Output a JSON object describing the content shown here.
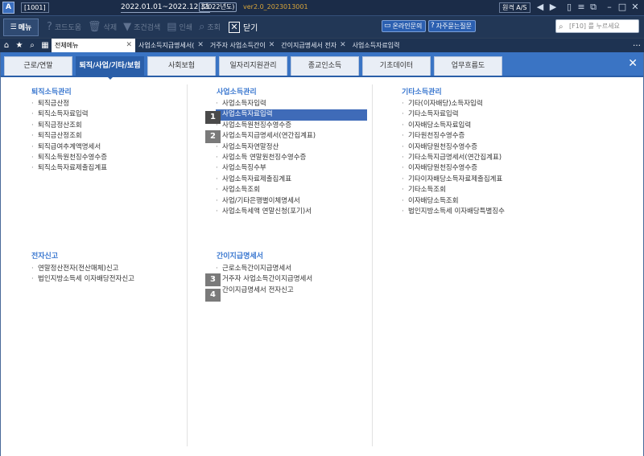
{
  "titlebar": {
    "company_code": "[1001]",
    "period": "2022.01.01~2022.12.31",
    "period_year": "(2022년도)",
    "version": "ver2.0_2023013001",
    "remote_label": "원격 A/S"
  },
  "toolbar": {
    "menu_label": "메뉴",
    "code_help": "코드도움",
    "delete": "삭제",
    "condition_search": "조건검색",
    "print": "인쇄",
    "inquiry": "조회",
    "close": "닫기",
    "online_inquiry": "온라인문의",
    "faq": "자주묻는질문",
    "search_placeholder": "[F10] 를 누르세요"
  },
  "doc_tabs": [
    {
      "label": "전체메뉴"
    },
    {
      "label": "사업소득지급명세서("
    },
    {
      "label": "거주자 사업소득간이"
    },
    {
      "label": "간이지급명세서 전자"
    },
    {
      "label": "사업소득자료입력"
    }
  ],
  "tab_overflow": "…",
  "category_tabs": [
    "근로/연말",
    "퇴직/사업/기타/보험",
    "사회보험",
    "일자리지원관리",
    "종교인소득",
    "기초데이터",
    "업무흐름도"
  ],
  "active_category_index": 1,
  "sections": {
    "retirement": {
      "title": "퇴직소득관리",
      "items": [
        "퇴직금산정",
        "퇴직소득자료입력",
        "퇴직금정산조회",
        "퇴직금산정조회",
        "퇴직급여추계액명세서",
        "퇴직소득원천징수영수증",
        "퇴직소득자료제출집계표"
      ]
    },
    "business": {
      "title": "사업소득관리",
      "items": [
        "사업소득자입력",
        "사업소득자료입력",
        "사업소득원천징수영수증",
        "사업소득지급명세서(연간집계표)",
        "사업소득자연말정산",
        "사업소득 연말원천징수영수증",
        "사업소득징수부",
        "사업소득자료제출집계표",
        "사업소득조회",
        "사업/기타은행별이체명세서",
        "사업소득세액 연말신청(포기)서"
      ],
      "highlight_index": 1
    },
    "other": {
      "title": "기타소득관리",
      "items": [
        "기타(이자배당)소득자입력",
        "기타소득자료입력",
        "이자배당소득자료입력",
        "기타원천징수영수증",
        "이자배당원천징수영수증",
        "기타소득지급명세서(연간집계표)",
        "이자배당원천징수영수증",
        "기타이자배당소득자료제출집계표",
        "기타소득조회",
        "이자배당소득조회",
        "법인지방소득세 이자배당특별징수"
      ]
    },
    "e_filing": {
      "title": "전자신고",
      "items": [
        "연말정산전자(전산매체)신고",
        "법인지방소득세 이자배당전자신고"
      ]
    },
    "simple_statement": {
      "title": "간이지급명세서",
      "items": [
        "근로소득간이지급명세서",
        "거주자 사업소득간이지급명세서",
        "간이지급명세서 전자신고"
      ]
    }
  },
  "badges": [
    "1",
    "2",
    "3",
    "4"
  ],
  "colors": {
    "accent": "#3a74c4",
    "active_tab": "#2a5ea8",
    "section_title": "#3b78d0",
    "highlight": "#3f6bb8"
  }
}
